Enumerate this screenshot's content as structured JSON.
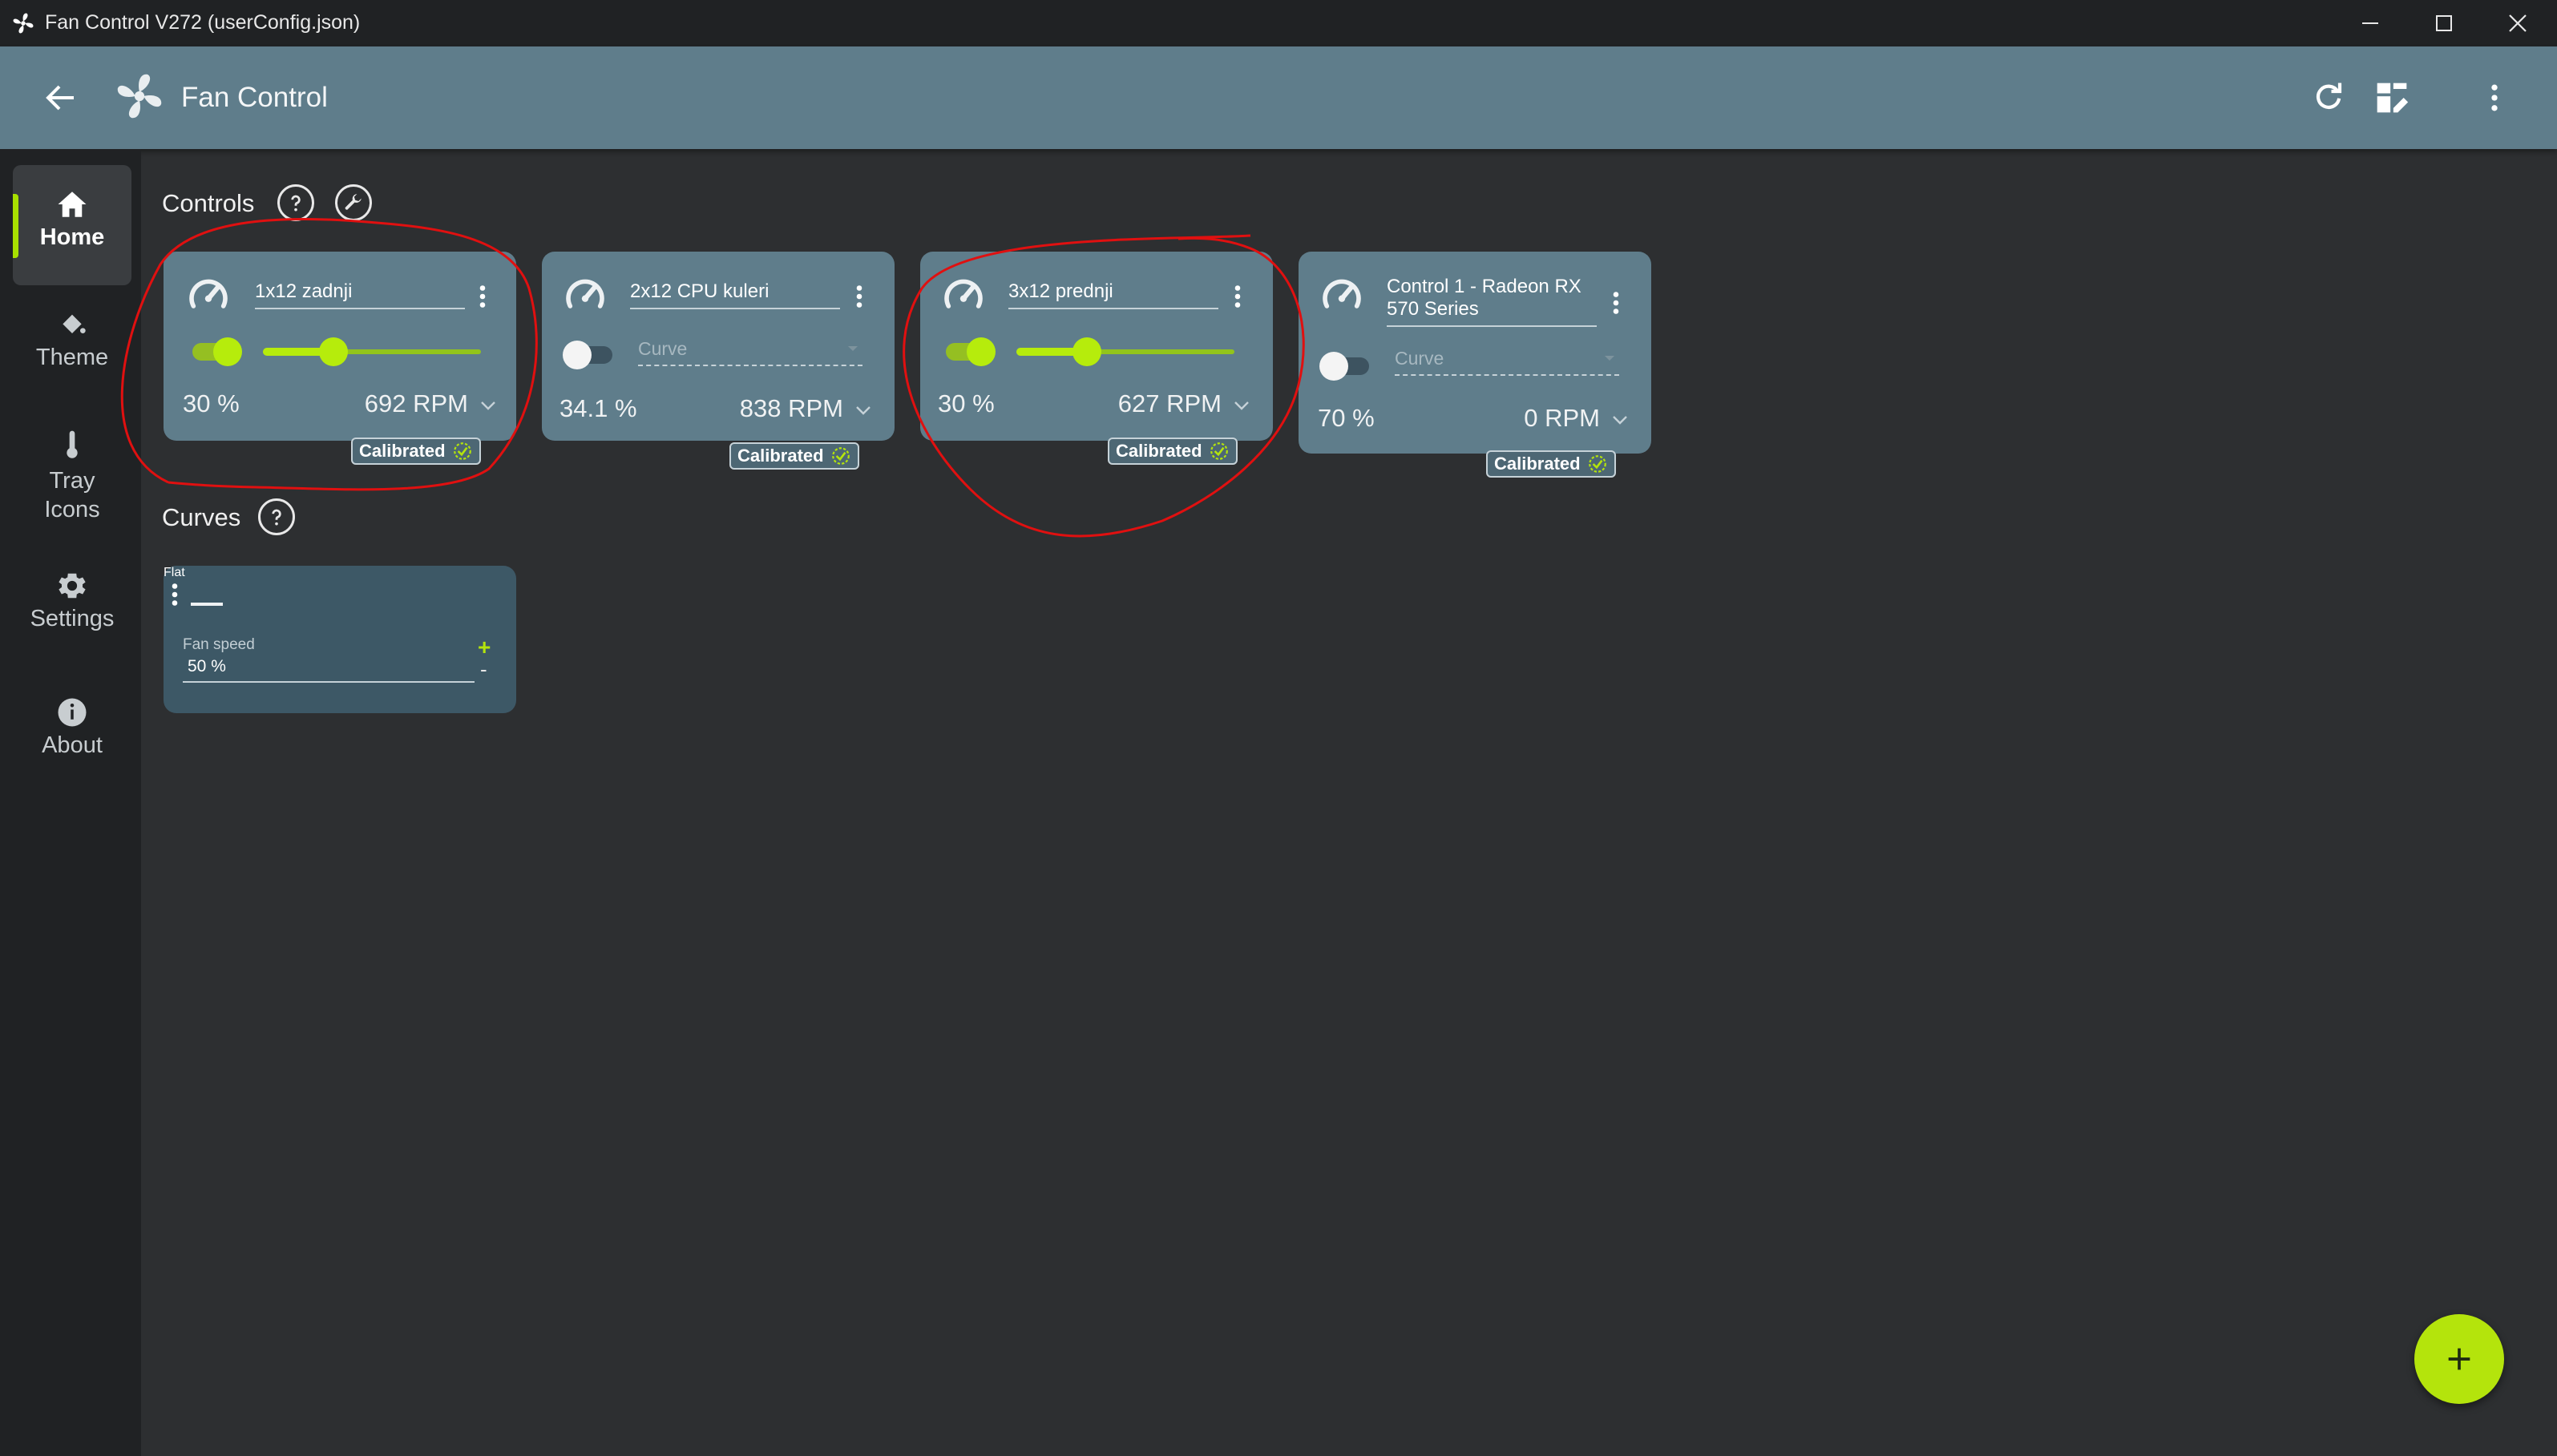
{
  "window": {
    "title": "Fan Control V272 (userConfig.json)"
  },
  "header": {
    "title": "Fan Control",
    "actions": [
      "refresh-icon",
      "dashboard-edit-icon",
      "more-vert-icon"
    ]
  },
  "sidebar": {
    "items": [
      {
        "label": "Home",
        "icon": "home-icon",
        "active": true
      },
      {
        "label": "Theme",
        "icon": "paint-bucket-icon",
        "active": false
      },
      {
        "label": "Tray\nIcons",
        "line1": "Tray",
        "line2": "Icons",
        "icon": "thermometer-icon",
        "active": false
      },
      {
        "label": "Settings",
        "icon": "gear-icon",
        "active": false
      },
      {
        "label": "About",
        "icon": "info-icon",
        "active": false
      }
    ]
  },
  "controls": {
    "title": "Controls",
    "cards": [
      {
        "name": "1x12 zadnji",
        "enabled": true,
        "percent": "30 %",
        "rpm": "692 RPM",
        "slider_fraction": 0.3,
        "badge": "Calibrated"
      },
      {
        "name": "2x12 CPU kuleri",
        "enabled": false,
        "curve_placeholder": "Curve",
        "percent": "34.1 %",
        "rpm": "838 RPM",
        "badge": "Calibrated"
      },
      {
        "name": "3x12 prednji",
        "enabled": true,
        "percent": "30 %",
        "rpm": "627 RPM",
        "slider_fraction": 0.3,
        "badge": "Calibrated"
      },
      {
        "name": "Control 1 - Radeon RX 570 Series",
        "name_line1": "Control 1 - Radeon RX",
        "name_line2": "570 Series",
        "enabled": false,
        "curve_placeholder": "Curve",
        "percent": "70 %",
        "rpm": "0 RPM",
        "badge": "Calibrated"
      }
    ]
  },
  "curves": {
    "title": "Curves",
    "cards": [
      {
        "name": "Flat",
        "icon": "flat-line-icon",
        "field_label": "Fan speed",
        "value": "50 %",
        "plus": "+",
        "minus": "-"
      }
    ]
  },
  "fab": {
    "icon": "plus-icon"
  },
  "colors": {
    "accent": "#b4e40c",
    "card": "#5f7d8b",
    "curve_card": "#3d5866",
    "annotation": "#e01010"
  }
}
